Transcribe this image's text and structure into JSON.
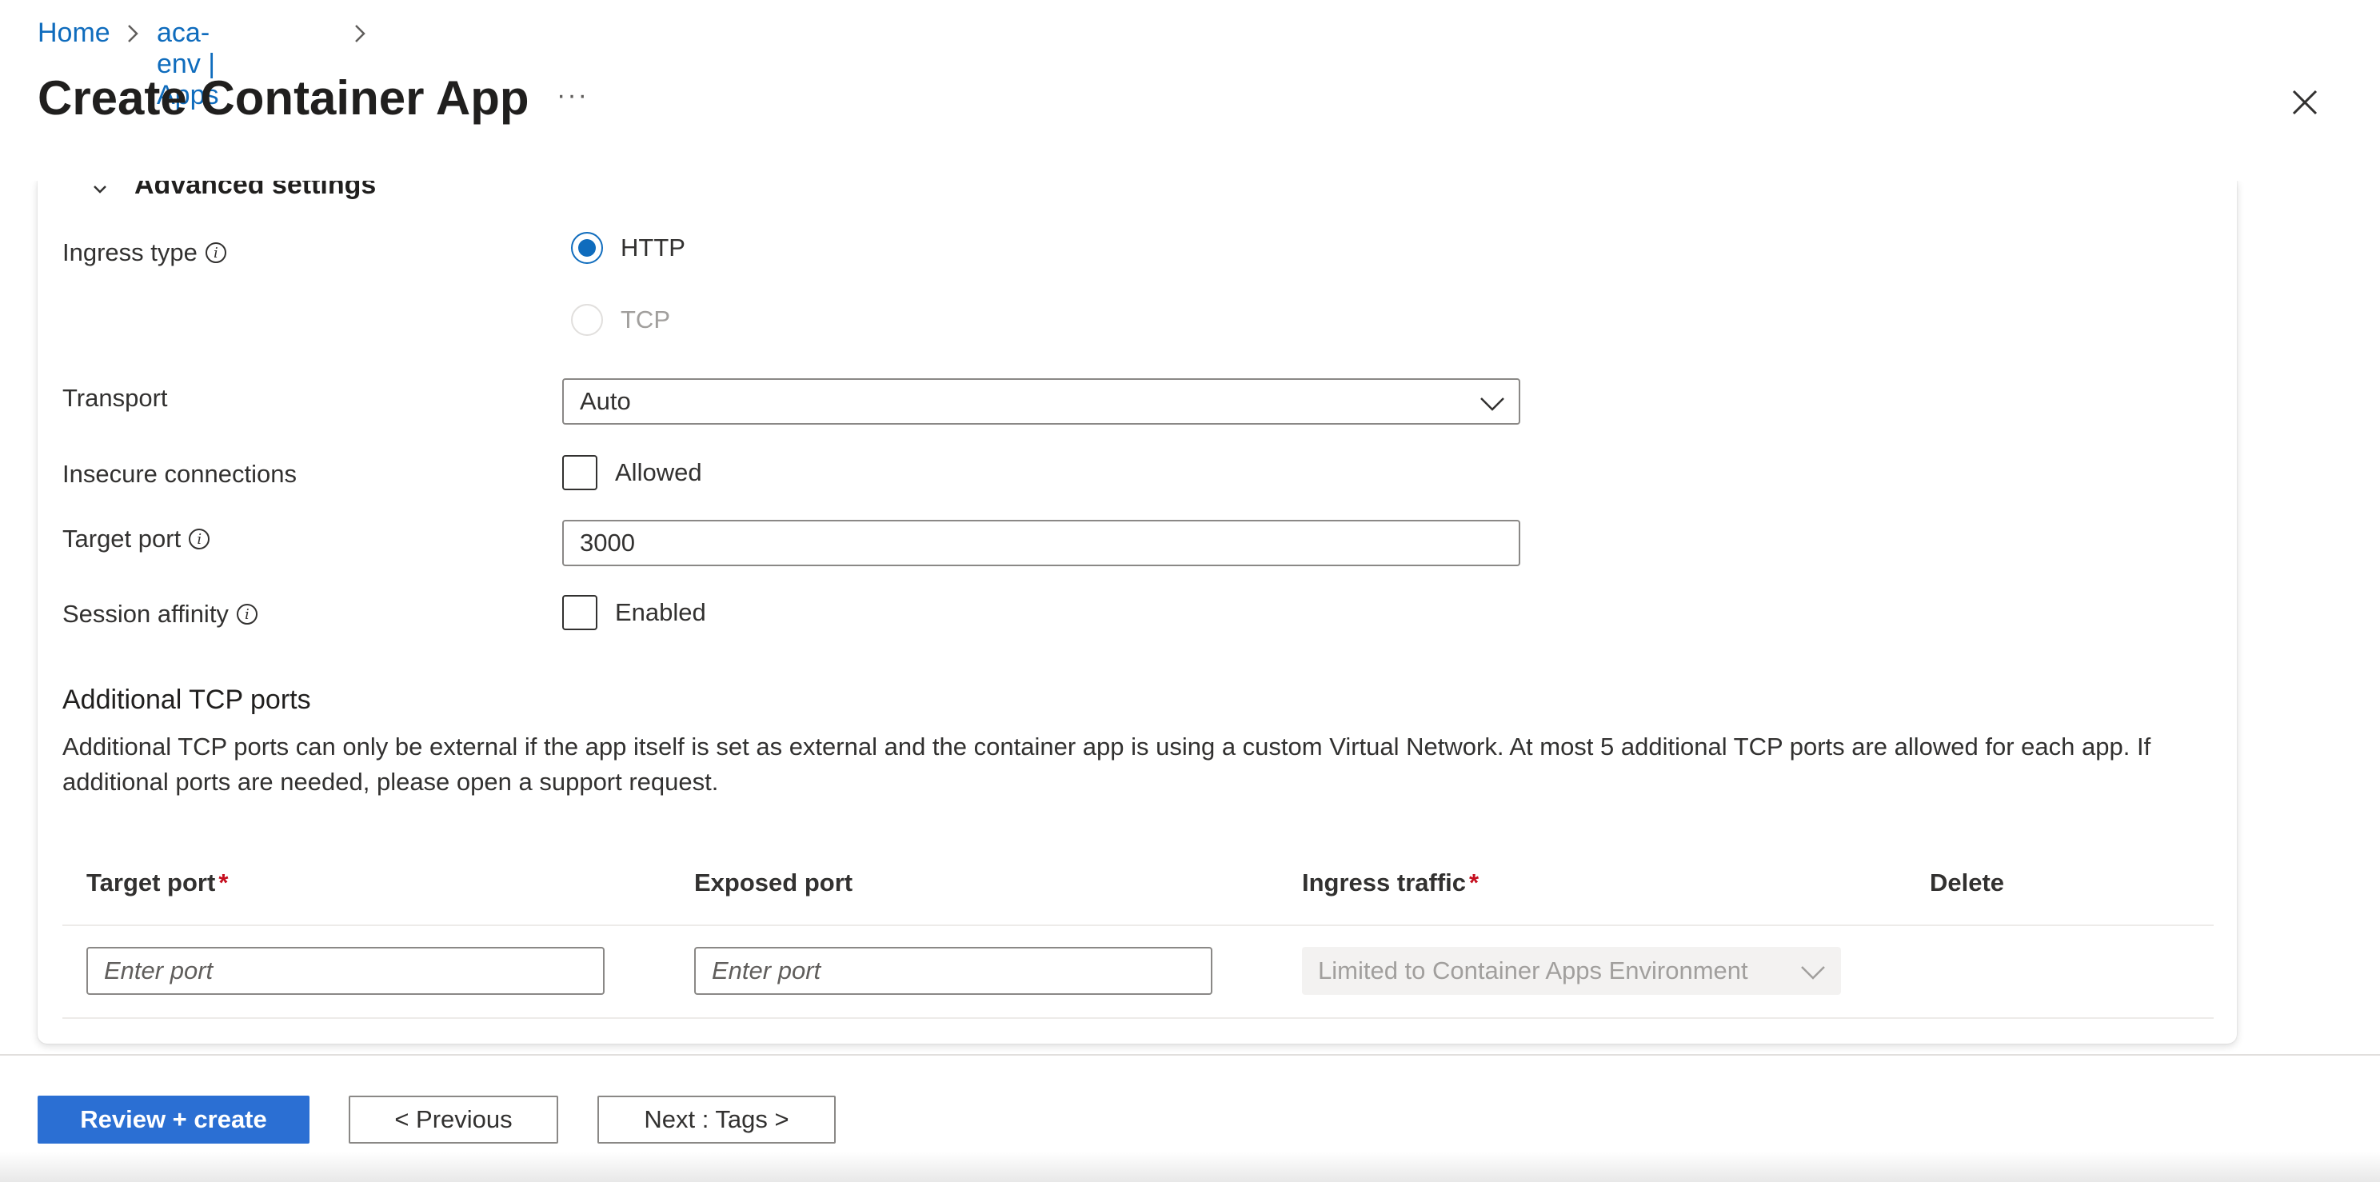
{
  "breadcrumb": {
    "items": [
      "Home",
      "aca-env | Apps"
    ]
  },
  "header": {
    "title": "Create Container App",
    "more_label": "···"
  },
  "advanced": {
    "title": "Advanced settings",
    "ingress_type": {
      "label": "Ingress type",
      "options": [
        "HTTP",
        "TCP"
      ],
      "selected": "HTTP"
    },
    "transport": {
      "label": "Transport",
      "value": "Auto"
    },
    "insecure": {
      "label": "Insecure connections",
      "checkbox_label": "Allowed",
      "checked": false
    },
    "target_port": {
      "label": "Target port",
      "value": "3000"
    },
    "session_affinity": {
      "label": "Session affinity",
      "checkbox_label": "Enabled",
      "checked": false
    }
  },
  "tcp_ports": {
    "title": "Additional TCP ports",
    "description": "Additional TCP ports can only be external if the app itself is set as external and the container app is using a custom Virtual Network. At most 5 additional TCP ports are allowed for each app. If additional ports are needed, please open a support request.",
    "columns": {
      "target_port": "Target port",
      "exposed_port": "Exposed port",
      "ingress_traffic": "Ingress traffic",
      "delete": "Delete"
    },
    "required_marker": "*",
    "row": {
      "target_placeholder": "Enter port",
      "exposed_placeholder": "Enter port",
      "ingress_value": "Limited to Container Apps Environment"
    }
  },
  "footer": {
    "review_label": "Review + create",
    "previous_label": "< Previous",
    "next_label": "Next : Tags >"
  },
  "colors": {
    "accent": "#0f6cbd",
    "primary_button": "#2b6fd3",
    "required": "#c50f1f"
  },
  "icons": [
    "chevron-right-icon",
    "close-icon",
    "chevron-down-icon",
    "info-icon"
  ]
}
